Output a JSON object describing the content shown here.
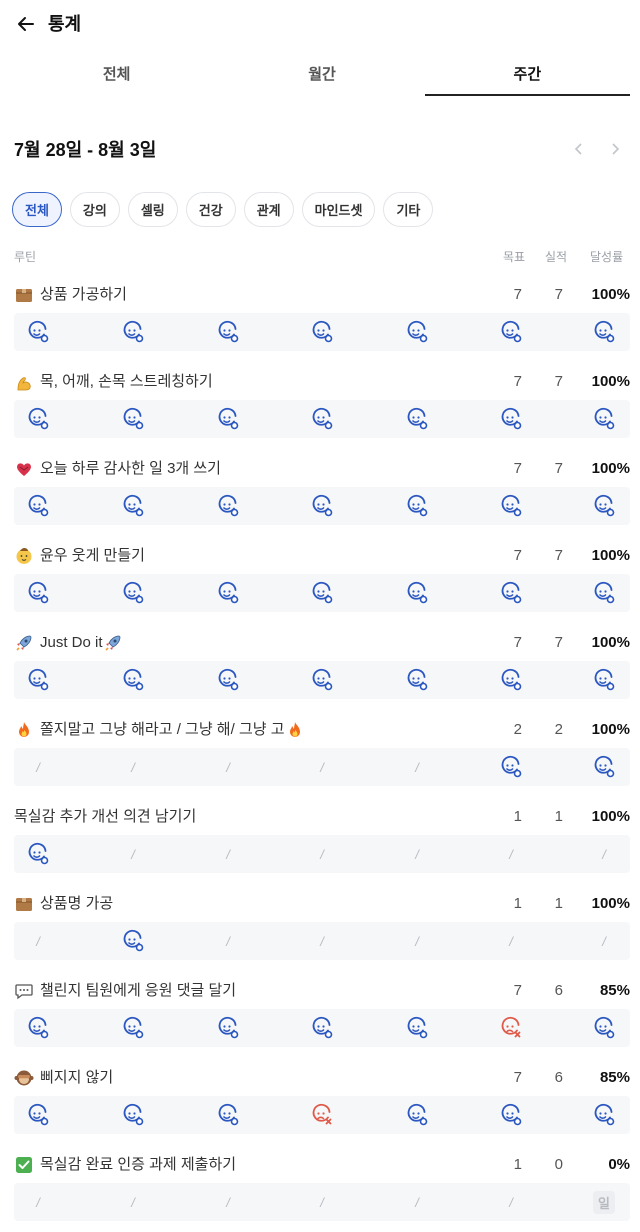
{
  "header": {
    "title": "통계"
  },
  "tabs": [
    {
      "label": "전체"
    },
    {
      "label": "월간"
    },
    {
      "label": "주간"
    }
  ],
  "week": {
    "range": "7월 28일 - 8월 3일"
  },
  "chips": [
    {
      "label": "전체"
    },
    {
      "label": "강의"
    },
    {
      "label": "셀링"
    },
    {
      "label": "건강"
    },
    {
      "label": "관계"
    },
    {
      "label": "마인드셋"
    },
    {
      "label": "기타"
    }
  ],
  "columns": {
    "routine": "루틴",
    "goal": "목표",
    "actual": "실적",
    "rate": "달성률"
  },
  "colors": {
    "accent": "#2b57c0",
    "fail": "#e05a4a",
    "muted": "#b7bac0",
    "row_bg": "#f6f7f9"
  },
  "routines": [
    {
      "icon": "package-emoji-icon",
      "name": "상품 가공하기",
      "goal": "7",
      "actual": "7",
      "rate": "100%",
      "days": [
        "ok",
        "ok",
        "ok",
        "ok",
        "ok",
        "ok",
        "ok"
      ]
    },
    {
      "icon": "flexed-bicep-emoji-icon",
      "name": "목, 어깨, 손목 스트레칭하기",
      "goal": "7",
      "actual": "7",
      "rate": "100%",
      "days": [
        "ok",
        "ok",
        "ok",
        "ok",
        "ok",
        "ok",
        "ok"
      ]
    },
    {
      "icon": "heart-emoji-icon",
      "name": "오늘 하루 감사한 일 3개 쓰기",
      "goal": "7",
      "actual": "7",
      "rate": "100%",
      "days": [
        "ok",
        "ok",
        "ok",
        "ok",
        "ok",
        "ok",
        "ok"
      ]
    },
    {
      "icon": "baby-face-emoji-icon",
      "name": "윤우 웃게 만들기",
      "goal": "7",
      "actual": "7",
      "rate": "100%",
      "days": [
        "ok",
        "ok",
        "ok",
        "ok",
        "ok",
        "ok",
        "ok"
      ]
    },
    {
      "icon": "rocket-emoji-icon",
      "name": "Just Do it",
      "trail_icon": "rocket-emoji-icon",
      "goal": "7",
      "actual": "7",
      "rate": "100%",
      "days": [
        "ok",
        "ok",
        "ok",
        "ok",
        "ok",
        "ok",
        "ok"
      ]
    },
    {
      "icon": "fire-emoji-icon",
      "name": "쫄지말고 그냥 해라고 / 그냥 해/ 그냥 고",
      "trail_icon": "fire-emoji-icon",
      "goal": "2",
      "actual": "2",
      "rate": "100%",
      "days": [
        "none",
        "none",
        "none",
        "none",
        "none",
        "ok",
        "ok"
      ]
    },
    {
      "icon": "",
      "name": "목실감 추가 개선 의견 남기기",
      "goal": "1",
      "actual": "1",
      "rate": "100%",
      "days": [
        "ok",
        "none",
        "none",
        "none",
        "none",
        "none",
        "none"
      ]
    },
    {
      "icon": "package-emoji-icon",
      "name": "상품명 가공",
      "goal": "1",
      "actual": "1",
      "rate": "100%",
      "days": [
        "none",
        "ok",
        "none",
        "none",
        "none",
        "none",
        "none"
      ]
    },
    {
      "icon": "speech-bubble-emoji-icon",
      "name": "챌린지 팀원에게 응원 댓글 달기",
      "goal": "7",
      "actual": "6",
      "rate": "85%",
      "days": [
        "ok",
        "ok",
        "ok",
        "ok",
        "ok",
        "fail",
        "ok"
      ]
    },
    {
      "icon": "monkey-emoji-icon",
      "name": "삐지지 않기",
      "goal": "7",
      "actual": "6",
      "rate": "85%",
      "days": [
        "ok",
        "ok",
        "ok",
        "fail",
        "ok",
        "ok",
        "ok"
      ]
    },
    {
      "icon": "check-box-emoji-icon",
      "name": "목실감 완료 인증 과제 제출하기",
      "goal": "1",
      "actual": "0",
      "rate": "0%",
      "days": [
        "none",
        "none",
        "none",
        "none",
        "none",
        "none",
        "label"
      ],
      "day_label": "일"
    }
  ]
}
